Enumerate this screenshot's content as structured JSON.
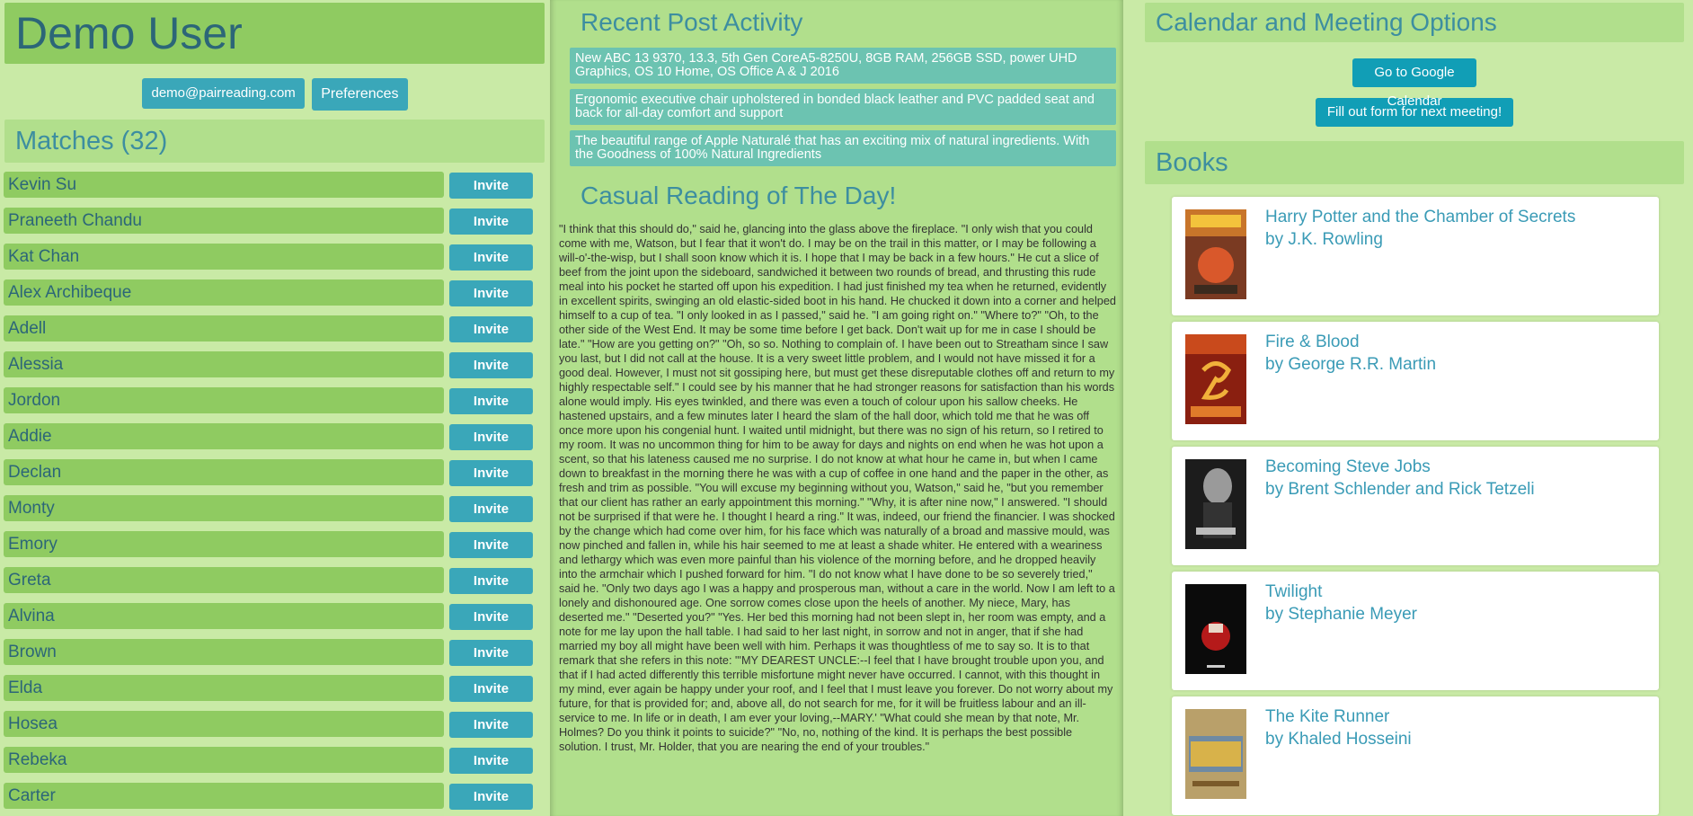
{
  "user": {
    "name": "Demo User",
    "email_button": "demo@pairreading.com",
    "preferences_button": "Preferences"
  },
  "matches": {
    "header": "Matches (32)",
    "invite_label": "Invite",
    "items": [
      "Kevin Su",
      "Praneeth Chandu",
      "Kat Chan",
      "Alex Archibeque",
      "Adell",
      "Alessia",
      "Jordon",
      "Addie",
      "Declan",
      "Monty",
      "Emory",
      "Greta",
      "Alvina",
      "Brown",
      "Elda",
      "Hosea",
      "Rebeka",
      "Carter"
    ]
  },
  "activity": {
    "header": "Recent Post Activity",
    "posts": [
      "New ABC 13 9370, 13.3, 5th Gen CoreA5-8250U, 8GB RAM, 256GB SSD, power UHD Graphics, OS 10 Home, OS Office A & J 2016",
      "Ergonomic executive chair upholstered in bonded black leather and PVC padded seat and back for all-day comfort and support",
      "The beautiful range of Apple Naturalé that has an exciting mix of natural ingredients. With the Goodness of 100% Natural Ingredients"
    ]
  },
  "reading": {
    "header": "Casual Reading of The Day!",
    "text": "\"I think that this should do,\" said he, glancing into the glass above the fireplace. \"I only wish that you could come with me, Watson, but I fear that it won't do. I may be on the trail in this matter, or I may be following a will-o'-the-wisp, but I shall soon know which it is. I hope that I may be back in a few hours.\" He cut a slice of beef from the joint upon the sideboard, sandwiched it between two rounds of bread, and thrusting this rude meal into his pocket he started off upon his expedition. I had just finished my tea when he returned, evidently in excellent spirits, swinging an old elastic-sided boot in his hand. He chucked it down into a corner and helped himself to a cup of tea. \"I only looked in as I passed,\" said he. \"I am going right on.\" \"Where to?\" \"Oh, to the other side of the West End. It may be some time before I get back. Don't wait up for me in case I should be late.\" \"How are you getting on?\" \"Oh, so so. Nothing to complain of. I have been out to Streatham since I saw you last, but I did not call at the house. It is a very sweet little problem, and I would not have missed it for a good deal. However, I must not sit gossiping here, but must get these disreputable clothes off and return to my highly respectable self.\" I could see by his manner that he had stronger reasons for satisfaction than his words alone would imply. His eyes twinkled, and there was even a touch of colour upon his sallow cheeks. He hastened upstairs, and a few minutes later I heard the slam of the hall door, which told me that he was off once more upon his congenial hunt. I waited until midnight, but there was no sign of his return, so I retired to my room. It was no uncommon thing for him to be away for days and nights on end when he was hot upon a scent, so that his lateness caused me no surprise. I do not know at what hour he came in, but when I came down to breakfast in the morning there he was with a cup of coffee in one hand and the paper in the other, as fresh and trim as possible. \"You will excuse my beginning without you, Watson,\" said he, \"but you remember that our client has rather an early appointment this morning.\" \"Why, it is after nine now,\" I answered. \"I should not be surprised if that were he. I thought I heard a ring.\" It was, indeed, our friend the financier. I was shocked by the change which had come over him, for his face which was naturally of a broad and massive mould, was now pinched and fallen in, while his hair seemed to me at least a shade whiter. He entered with a weariness and lethargy which was even more painful than his violence of the morning before, and he dropped heavily into the armchair which I pushed forward for him. \"I do not know what I have done to be so severely tried,\" said he. \"Only two days ago I was a happy and prosperous man, without a care in the world. Now I am left to a lonely and dishonoured age. One sorrow comes close upon the heels of another. My niece, Mary, has deserted me.\" \"Deserted you?\" \"Yes. Her bed this morning had not been slept in, her room was empty, and a note for me lay upon the hall table. I had said to her last night, in sorrow and not in anger, that if she had married my boy all might have been well with him. Perhaps it was thoughtless of me to say so. It is to that remark that she refers in this note: \"'MY DEAREST UNCLE:--I feel that I have brought trouble upon you, and that if I had acted differently this terrible misfortune might never have occurred. I cannot, with this thought in my mind, ever again be happy under your roof, and I feel that I must leave you forever. Do not worry about my future, for that is provided for; and, above all, do not search for me, for it will be fruitless labour and an ill-service to me. In life or in death, I am ever your loving,--MARY.' \"What could she mean by that note, Mr. Holmes? Do you think it points to suicide?\" \"No, no, nothing of the kind. It is perhaps the best possible solution. I trust, Mr. Holder, that you are nearing the end of your troubles.\""
  },
  "calendar": {
    "header": "Calendar and Meeting Options",
    "google_button": "Go to Google Calendar",
    "form_button": "Fill out form for next meeting!"
  },
  "books": {
    "header": "Books",
    "items": [
      {
        "title": "Harry Potter and the Chamber of Secrets",
        "author": "by J.K. Rowling"
      },
      {
        "title": "Fire & Blood",
        "author": "by George R.R. Martin"
      },
      {
        "title": "Becoming Steve Jobs",
        "author": "by Brent Schlender and Rick Tetzeli"
      },
      {
        "title": "Twilight",
        "author": "by Stephanie Meyer"
      },
      {
        "title": "The Kite Runner",
        "author": "by Khaled Hosseini"
      }
    ]
  }
}
